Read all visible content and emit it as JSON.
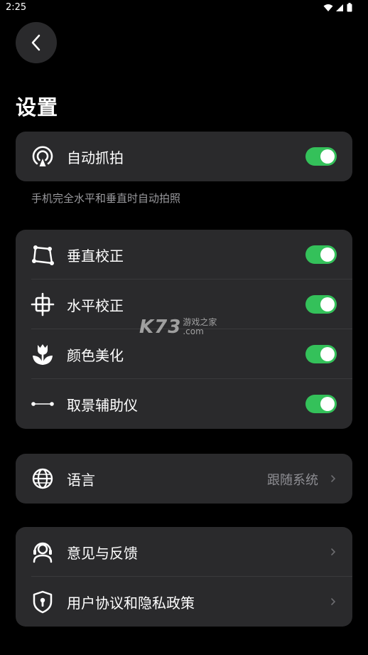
{
  "status_bar": {
    "time": "2:25"
  },
  "page": {
    "title": "设置"
  },
  "auto_capture": {
    "label": "自动抓拍",
    "enabled": true,
    "description": "手机完全水平和垂直时自动拍照"
  },
  "corrections": [
    {
      "label": "垂直校正",
      "icon": "perspective-crop-icon",
      "enabled": true
    },
    {
      "label": "水平校正",
      "icon": "horizon-level-icon",
      "enabled": true
    },
    {
      "label": "颜色美化",
      "icon": "tulip-icon",
      "enabled": true
    },
    {
      "label": "取景辅助仪",
      "icon": "level-line-icon",
      "enabled": true
    }
  ],
  "language": {
    "label": "语言",
    "value": "跟随系统"
  },
  "about": [
    {
      "label": "意见与反馈",
      "icon": "feedback-person-icon"
    },
    {
      "label": "用户协议和隐私政策",
      "icon": "shield-lock-icon"
    }
  ],
  "watermark": {
    "brand": "K73",
    "text_top": "游戏之家",
    "text_bottom": ".com"
  },
  "colors": {
    "background": "#000000",
    "card": "#2a2a2c",
    "toggle_on": "#34c15a",
    "secondary_text": "#8e8e93"
  }
}
